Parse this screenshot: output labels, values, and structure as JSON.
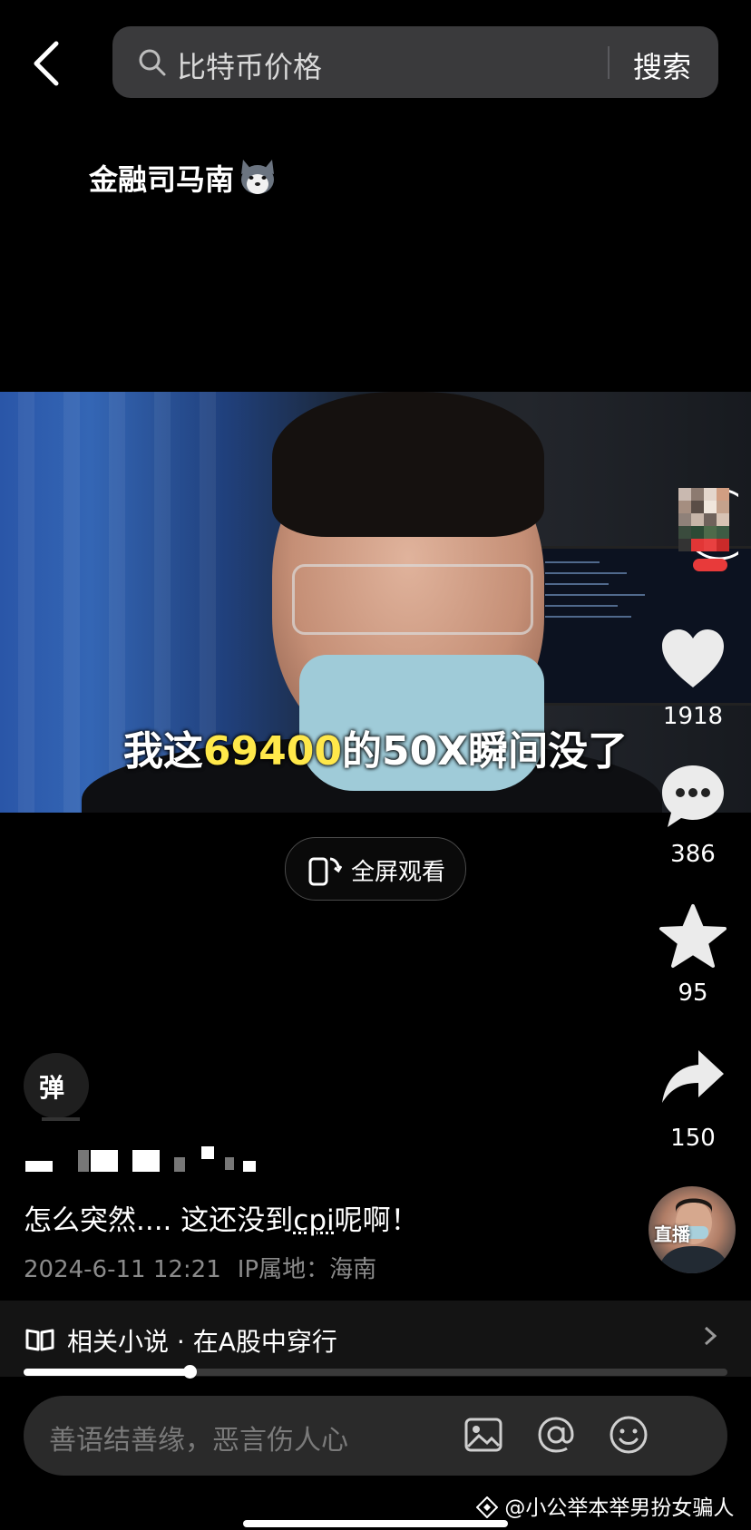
{
  "search": {
    "query": "比特币价格",
    "button_label": "搜索"
  },
  "author": {
    "name": "金融司马南",
    "emoji_icon": "husky-face-icon"
  },
  "video": {
    "subtitle_pre": "我这",
    "subtitle_highlight": "69400",
    "subtitle_post": "的50X瞬间没了",
    "highlight_color": "#ffe84a",
    "fullscreen_label": "全屏观看"
  },
  "actions": {
    "like_count": "1918",
    "comment_count": "386",
    "favorite_count": "95",
    "share_count": "150"
  },
  "danmu": {
    "label": "弹"
  },
  "post": {
    "caption_pre": "怎么突然.... 这还没到",
    "caption_link": "cpi",
    "caption_post": "呢啊！",
    "date": "2024-6-11 12:21",
    "location": "IP属地：海南"
  },
  "live": {
    "label": "直播"
  },
  "novel": {
    "text": "相关小说 · 在A股中穿行"
  },
  "playback": {
    "progress": 0.236
  },
  "comment_input": {
    "placeholder": "善语结善缘，恶言伤人心"
  },
  "watermark": {
    "text": "@小公举本举男扮女骗人"
  }
}
